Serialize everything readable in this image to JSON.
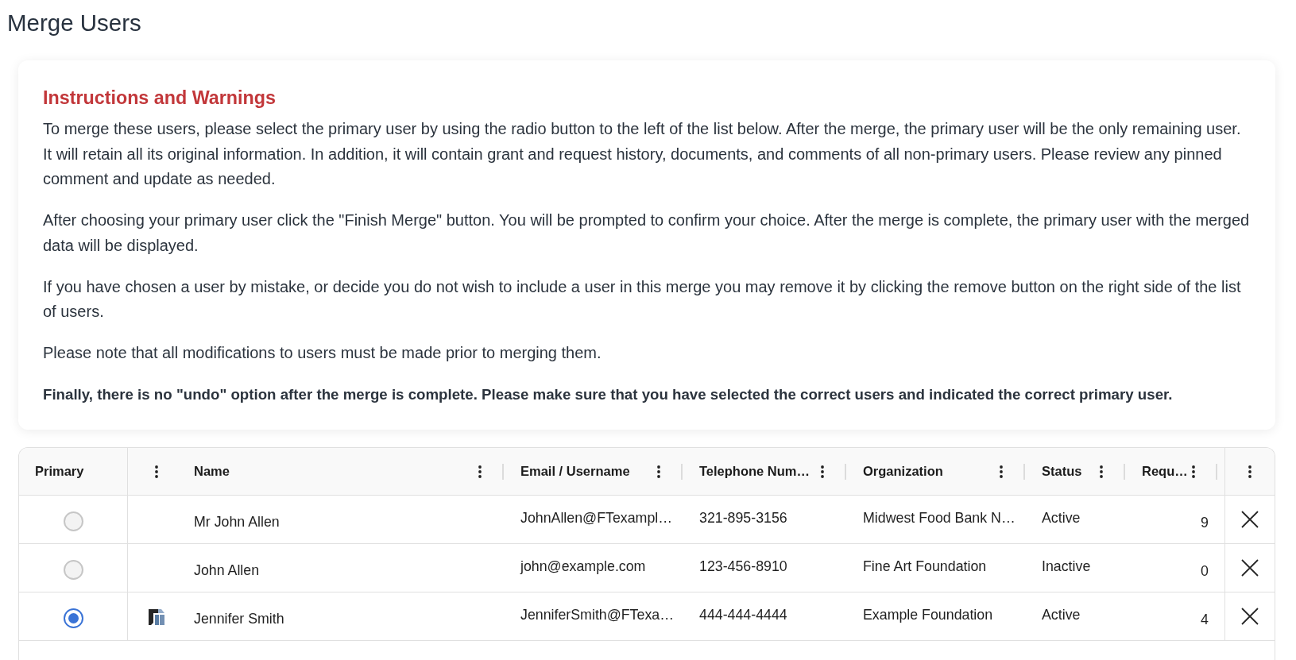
{
  "page": {
    "title": "Merge Users"
  },
  "instructions": {
    "heading": "Instructions and Warnings",
    "paragraphs": [
      {
        "text": "To merge these users, please select the primary user by using the radio button to the left of the list below. After the merge, the primary user will be the only remaining user. It will retain all its original information. In addition, it will contain grant and request history, documents, and comments of all non-primary users. Please review any pinned comment and update as needed.",
        "strong": false
      },
      {
        "text": "After choosing your primary user click the \"Finish Merge\" button. You will be prompted to confirm your choice. After the merge is complete, the primary user with the merged data will be displayed.",
        "strong": false
      },
      {
        "text": "If you have chosen a user by mistake, or decide you do not wish to include a user in this merge you may remove it by clicking the remove button on the right side of the list of users.",
        "strong": false
      },
      {
        "text": "Please note that all modifications to users must be made prior to merging them.",
        "strong": false
      },
      {
        "text": "Finally, there is no \"undo\" option after the merge is complete. Please make sure that you have selected the correct users and indicated the correct primary user.",
        "strong": true
      }
    ]
  },
  "table": {
    "columns": [
      {
        "label": "Primary",
        "menu": false
      },
      {
        "menu": true
      },
      {
        "label": "Name",
        "menu": true
      },
      {
        "label": "Email / Username",
        "menu": true
      },
      {
        "label": "Telephone Num…",
        "menu": true
      },
      {
        "label": "Organization",
        "menu": true
      },
      {
        "label": "Status",
        "menu": true
      },
      {
        "label": "Requ…",
        "menu": true
      },
      {
        "menu": true
      }
    ],
    "rows": [
      {
        "selected": false,
        "icon_shown": false,
        "name": "Mr John Allen",
        "email": "JohnAllen@FTexampl…",
        "telephone": "321-895-3156",
        "organization": "Midwest Food Bank N…",
        "status": "Active",
        "column_8": "9"
      },
      {
        "selected": false,
        "icon_shown": false,
        "name": "John Allen",
        "email": "john@example.com",
        "telephone": "123-456-8910",
        "organization": "Fine Art Foundation",
        "status": "Inactive",
        "column_8": "0"
      },
      {
        "selected": true,
        "icon_shown": true,
        "name": "Jennifer Smith",
        "email": "JenniferSmith@FTexa…",
        "telephone": "444-444-4444",
        "organization": "Example Foundation",
        "status": "Active",
        "column_8": "4"
      }
    ]
  }
}
